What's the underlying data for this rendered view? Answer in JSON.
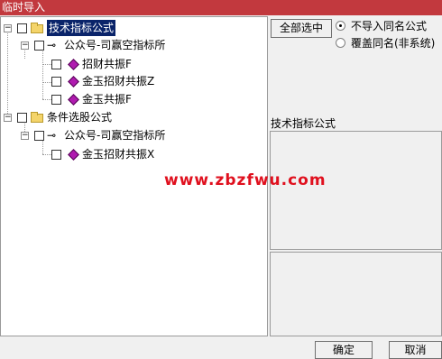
{
  "window": {
    "title": "临时导入"
  },
  "tree": {
    "group1": {
      "label": "技术指标公式",
      "child": {
        "label": "公众号-司赢空指标所",
        "items": [
          "招财共振F",
          "金玉招财共振Z",
          "金玉共振F"
        ]
      }
    },
    "group2": {
      "label": "条件选股公式",
      "child": {
        "label": "公众号-司赢空指标所",
        "items": [
          "金玉招财共振X"
        ]
      }
    }
  },
  "controls": {
    "select_all": "全部选中",
    "radio_no_import": "不导入同名公式",
    "radio_overwrite": "覆盖同名(非系统)"
  },
  "detail": {
    "category": "技术指标公式"
  },
  "watermark": "www.zbzfwu.com",
  "footer": {
    "ok": "确定",
    "cancel": "取消"
  }
}
